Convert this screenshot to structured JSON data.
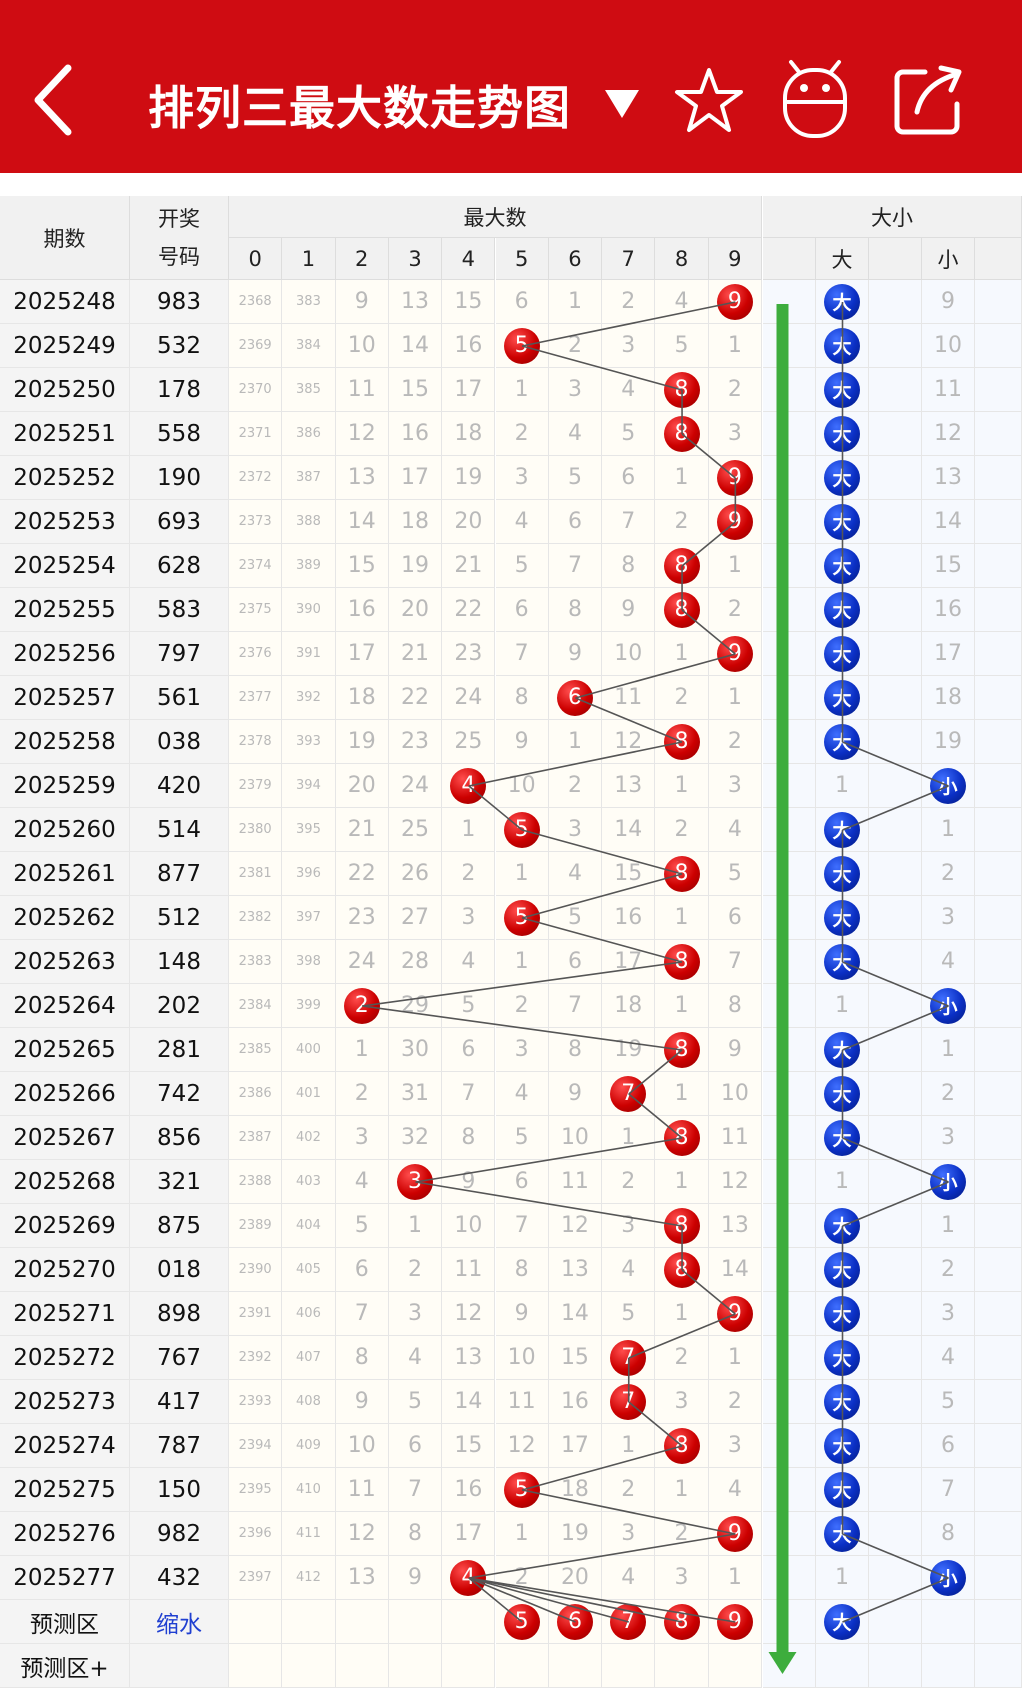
{
  "header": {
    "title": "排列三最大数走势图",
    "back_icon": "chevron-left-icon",
    "dropdown_icon": "triangle-down-icon",
    "star_icon": "star-icon",
    "robot_icon": "android-robot-icon",
    "share_icon": "share-icon"
  },
  "colors": {
    "header_bg": "#cf0c12",
    "red_ball": "#cc0000",
    "blue_ball": "#0a2fc4",
    "trend_arrow": "#3dad3d"
  },
  "table": {
    "col_issue": "期数",
    "col_draw_line1": "开奖",
    "col_draw_line2": "号码",
    "group_max": "最大数",
    "group_bs": "大小",
    "digits": [
      "0",
      "1",
      "2",
      "3",
      "4",
      "5",
      "6",
      "7",
      "8",
      "9"
    ],
    "bs_labels": [
      "大",
      "小"
    ],
    "rows": [
      {
        "issue": "2025248",
        "draw": "983",
        "cells": [
          "2368",
          "383",
          "9",
          "13",
          "15",
          "6",
          "1",
          "2",
          "4",
          "9"
        ],
        "bs": [
          "大",
          "9"
        ]
      },
      {
        "issue": "2025249",
        "draw": "532",
        "cells": [
          "2369",
          "384",
          "10",
          "14",
          "16",
          "5",
          "2",
          "3",
          "5",
          "1"
        ],
        "bs": [
          "大",
          "10"
        ]
      },
      {
        "issue": "2025250",
        "draw": "178",
        "cells": [
          "2370",
          "385",
          "11",
          "15",
          "17",
          "1",
          "3",
          "4",
          "8",
          "2"
        ],
        "bs": [
          "大",
          "11"
        ]
      },
      {
        "issue": "2025251",
        "draw": "558",
        "cells": [
          "2371",
          "386",
          "12",
          "16",
          "18",
          "2",
          "4",
          "5",
          "8",
          "3"
        ],
        "bs": [
          "大",
          "12"
        ]
      },
      {
        "issue": "2025252",
        "draw": "190",
        "cells": [
          "2372",
          "387",
          "13",
          "17",
          "19",
          "3",
          "5",
          "6",
          "1",
          "9"
        ],
        "bs": [
          "大",
          "13"
        ]
      },
      {
        "issue": "2025253",
        "draw": "693",
        "cells": [
          "2373",
          "388",
          "14",
          "18",
          "20",
          "4",
          "6",
          "7",
          "2",
          "9"
        ],
        "bs": [
          "大",
          "14"
        ]
      },
      {
        "issue": "2025254",
        "draw": "628",
        "cells": [
          "2374",
          "389",
          "15",
          "19",
          "21",
          "5",
          "7",
          "8",
          "8",
          "1"
        ],
        "bs": [
          "大",
          "15"
        ]
      },
      {
        "issue": "2025255",
        "draw": "583",
        "cells": [
          "2375",
          "390",
          "16",
          "20",
          "22",
          "6",
          "8",
          "9",
          "8",
          "2"
        ],
        "bs": [
          "大",
          "16"
        ]
      },
      {
        "issue": "2025256",
        "draw": "797",
        "cells": [
          "2376",
          "391",
          "17",
          "21",
          "23",
          "7",
          "9",
          "10",
          "1",
          "9"
        ],
        "bs": [
          "大",
          "17"
        ]
      },
      {
        "issue": "2025257",
        "draw": "561",
        "cells": [
          "2377",
          "392",
          "18",
          "22",
          "24",
          "8",
          "6",
          "11",
          "2",
          "1"
        ],
        "bs": [
          "大",
          "18"
        ]
      },
      {
        "issue": "2025258",
        "draw": "038",
        "cells": [
          "2378",
          "393",
          "19",
          "23",
          "25",
          "9",
          "1",
          "12",
          "8",
          "2"
        ],
        "bs": [
          "大",
          "19"
        ]
      },
      {
        "issue": "2025259",
        "draw": "420",
        "cells": [
          "2379",
          "394",
          "20",
          "24",
          "4",
          "10",
          "2",
          "13",
          "1",
          "3"
        ],
        "bs": [
          "1",
          "小"
        ]
      },
      {
        "issue": "2025260",
        "draw": "514",
        "cells": [
          "2380",
          "395",
          "21",
          "25",
          "1",
          "5",
          "3",
          "14",
          "2",
          "4"
        ],
        "bs": [
          "大",
          "1"
        ]
      },
      {
        "issue": "2025261",
        "draw": "877",
        "cells": [
          "2381",
          "396",
          "22",
          "26",
          "2",
          "1",
          "4",
          "15",
          "8",
          "5"
        ],
        "bs": [
          "大",
          "2"
        ]
      },
      {
        "issue": "2025262",
        "draw": "512",
        "cells": [
          "2382",
          "397",
          "23",
          "27",
          "3",
          "5",
          "5",
          "16",
          "1",
          "6"
        ],
        "bs": [
          "大",
          "3"
        ]
      },
      {
        "issue": "2025263",
        "draw": "148",
        "cells": [
          "2383",
          "398",
          "24",
          "28",
          "4",
          "1",
          "6",
          "17",
          "8",
          "7"
        ],
        "bs": [
          "大",
          "4"
        ]
      },
      {
        "issue": "2025264",
        "draw": "202",
        "cells": [
          "2384",
          "399",
          "2",
          "29",
          "5",
          "2",
          "7",
          "18",
          "1",
          "8"
        ],
        "bs": [
          "1",
          "小"
        ]
      },
      {
        "issue": "2025265",
        "draw": "281",
        "cells": [
          "2385",
          "400",
          "1",
          "30",
          "6",
          "3",
          "8",
          "19",
          "8",
          "9"
        ],
        "bs": [
          "大",
          "1"
        ]
      },
      {
        "issue": "2025266",
        "draw": "742",
        "cells": [
          "2386",
          "401",
          "2",
          "31",
          "7",
          "4",
          "9",
          "7",
          "1",
          "10"
        ],
        "bs": [
          "大",
          "2"
        ]
      },
      {
        "issue": "2025267",
        "draw": "856",
        "cells": [
          "2387",
          "402",
          "3",
          "32",
          "8",
          "5",
          "10",
          "1",
          "8",
          "11"
        ],
        "bs": [
          "大",
          "3"
        ]
      },
      {
        "issue": "2025268",
        "draw": "321",
        "cells": [
          "2388",
          "403",
          "4",
          "3",
          "9",
          "6",
          "11",
          "2",
          "1",
          "12"
        ],
        "bs": [
          "1",
          "小"
        ]
      },
      {
        "issue": "2025269",
        "draw": "875",
        "cells": [
          "2389",
          "404",
          "5",
          "1",
          "10",
          "7",
          "12",
          "3",
          "8",
          "13"
        ],
        "bs": [
          "大",
          "1"
        ]
      },
      {
        "issue": "2025270",
        "draw": "018",
        "cells": [
          "2390",
          "405",
          "6",
          "2",
          "11",
          "8",
          "13",
          "4",
          "8",
          "14"
        ],
        "bs": [
          "大",
          "2"
        ]
      },
      {
        "issue": "2025271",
        "draw": "898",
        "cells": [
          "2391",
          "406",
          "7",
          "3",
          "12",
          "9",
          "14",
          "5",
          "1",
          "9"
        ],
        "bs": [
          "大",
          "3"
        ]
      },
      {
        "issue": "2025272",
        "draw": "767",
        "cells": [
          "2392",
          "407",
          "8",
          "4",
          "13",
          "10",
          "15",
          "7",
          "2",
          "1"
        ],
        "bs": [
          "大",
          "4"
        ]
      },
      {
        "issue": "2025273",
        "draw": "417",
        "cells": [
          "2393",
          "408",
          "9",
          "5",
          "14",
          "11",
          "16",
          "7",
          "3",
          "2"
        ],
        "bs": [
          "大",
          "5"
        ]
      },
      {
        "issue": "2025274",
        "draw": "787",
        "cells": [
          "2394",
          "409",
          "10",
          "6",
          "15",
          "12",
          "17",
          "1",
          "8",
          "3"
        ],
        "bs": [
          "大",
          "6"
        ]
      },
      {
        "issue": "2025275",
        "draw": "150",
        "cells": [
          "2395",
          "410",
          "11",
          "7",
          "16",
          "5",
          "18",
          "2",
          "1",
          "4"
        ],
        "bs": [
          "大",
          "7"
        ]
      },
      {
        "issue": "2025276",
        "draw": "982",
        "cells": [
          "2396",
          "411",
          "12",
          "8",
          "17",
          "1",
          "19",
          "3",
          "2",
          "9"
        ],
        "bs": [
          "大",
          "8"
        ]
      },
      {
        "issue": "2025277",
        "draw": "432",
        "cells": [
          "2397",
          "412",
          "13",
          "9",
          "4",
          "2",
          "20",
          "4",
          "3",
          "1"
        ],
        "bs": [
          "1",
          "小"
        ]
      }
    ],
    "hits": [
      9,
      5,
      8,
      8,
      9,
      9,
      8,
      8,
      9,
      6,
      8,
      4,
      5,
      8,
      5,
      8,
      2,
      8,
      7,
      8,
      3,
      8,
      8,
      9,
      7,
      7,
      8,
      5,
      9,
      4
    ],
    "bs_hits": [
      0,
      0,
      0,
      0,
      0,
      0,
      0,
      0,
      0,
      0,
      0,
      1,
      0,
      0,
      0,
      0,
      1,
      0,
      0,
      0,
      1,
      0,
      0,
      0,
      0,
      0,
      0,
      0,
      0,
      1
    ],
    "predict_label": "预测区",
    "predict_link": "缩水",
    "predict_balls": [
      "5",
      "6",
      "7",
      "8",
      "9"
    ],
    "predict_bs": "大",
    "predict_plus_label": "预测区+"
  }
}
